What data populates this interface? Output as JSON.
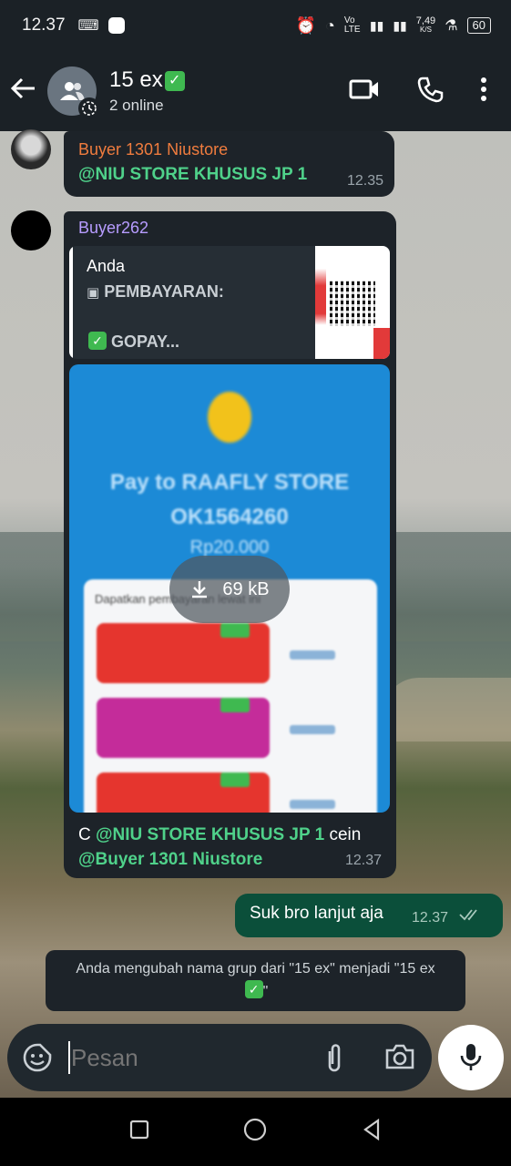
{
  "status_bar": {
    "time": "12.37",
    "network": "Vo LTE",
    "speed_value": "7,49",
    "speed_unit": "K/S",
    "battery": "60"
  },
  "header": {
    "title": "15 ex",
    "title_suffix": "✅",
    "subtitle": "2 online"
  },
  "messages": [
    {
      "sender": "Buyer 1301 Niustore",
      "sender_color": "#f07c3e",
      "text": "@NIU STORE KHUSUS JP 1",
      "time": "12.35"
    },
    {
      "sender": "Buyer262",
      "sender_color": "#b79cff",
      "reply": {
        "author": "Anda",
        "line1": "PEMBAYARAN:",
        "line2": "GOPAY..."
      },
      "media": {
        "size": "69 kB",
        "pay_to": "Pay to RAAFLY STORE",
        "account": "OK1564260",
        "amount": "Rp20.000",
        "card_title": "Dapatkan pembayaran lewat ini"
      },
      "caption_prefix": "C ",
      "caption_mention": "@NIU STORE KHUSUS JP 1",
      "caption_suffix": " cein",
      "caption_mention2": "@Buyer 1301 Niustore",
      "time": "12.37"
    },
    {
      "text": "Suk bro lanjut aja",
      "time": "12.37",
      "outgoing": true
    }
  ],
  "system_message": {
    "line1": "Anda mengubah nama grup dari \"15 ex\" menjadi \"15 ex",
    "line2_suffix": "\""
  },
  "input": {
    "placeholder": "Pesan"
  },
  "colors": {
    "mention": "#4fd18a",
    "outgoing_bubble": "#0b4f3a",
    "incoming_bubble": "#1d2329",
    "appbar": "#1b2126"
  }
}
